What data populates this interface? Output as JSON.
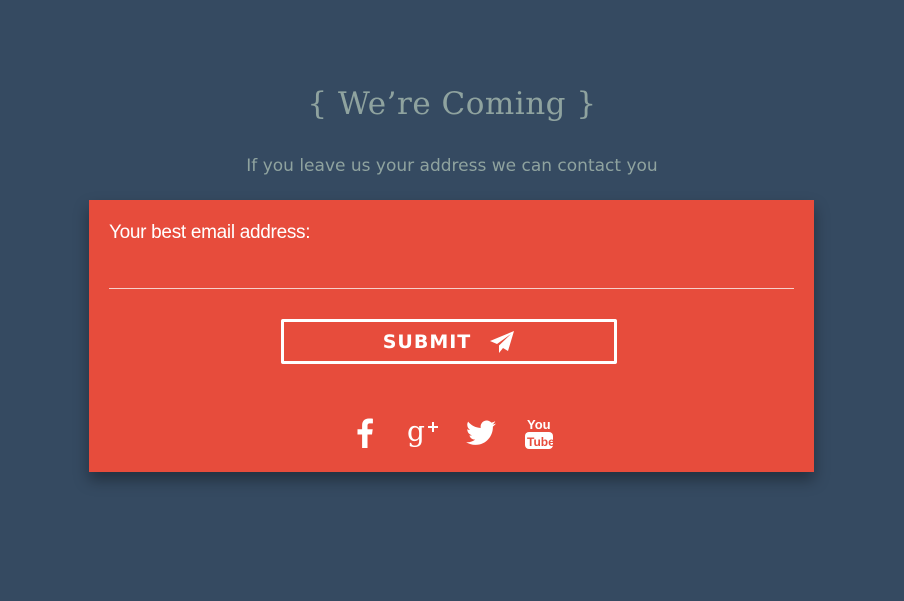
{
  "header": {
    "title": "{ We’re Coming }",
    "subtitle": "If you leave us your address we can contact you"
  },
  "form": {
    "email_label": "Your best email address:",
    "email_value": "",
    "submit_label": "SUBMIT"
  },
  "social": {
    "links": [
      "facebook-icon",
      "google-plus-icon",
      "twitter-icon",
      "youtube-icon"
    ],
    "youtube_you": "You",
    "youtube_tube": "Tube"
  },
  "colors": {
    "background": "#354a61",
    "card": "#e74c3c",
    "heading": "#8fa39f",
    "text": "#ffffff"
  }
}
